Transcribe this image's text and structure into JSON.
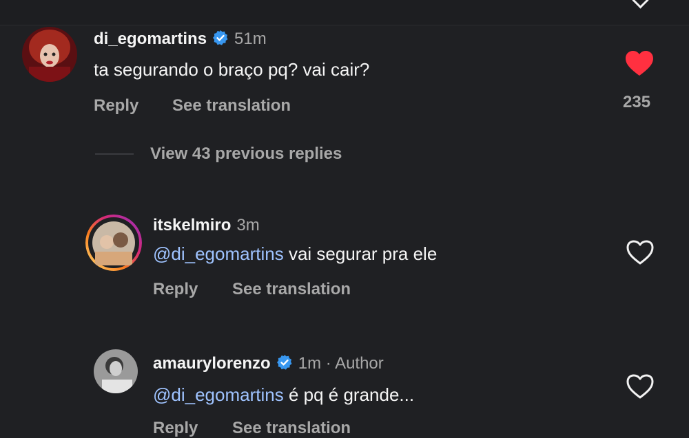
{
  "colors": {
    "background": "#1f2023",
    "mention": "#9fc3ff",
    "verified": "#3897f0",
    "liked_heart": "#ff3040",
    "muted_text": "#a8a8a8"
  },
  "comments": [
    {
      "username": "di_egomartins",
      "verified": true,
      "time": "51m",
      "text": "ta segurando o braço pq? vai cair?",
      "reply_label": "Reply",
      "translate_label": "See translation",
      "liked": true,
      "like_count": "235",
      "heart_icon": "heart-filled-icon"
    }
  ],
  "view_replies": "View 43 previous replies",
  "replies": [
    {
      "username": "itskelmiro",
      "verified": false,
      "time": "3m",
      "mention": "@di_egomartins",
      "text": " vai segurar pra ele",
      "reply_label": "Reply",
      "translate_label": "See translation",
      "liked": false,
      "heart_icon": "heart-outline-icon"
    },
    {
      "username": "amaurylorenzo",
      "verified": true,
      "time": "1m · Author",
      "mention": "@di_egomartins",
      "text": " é pq é grande...",
      "reply_label": "Reply",
      "translate_label": "See translation",
      "liked": false,
      "heart_icon": "heart-outline-icon"
    }
  ]
}
